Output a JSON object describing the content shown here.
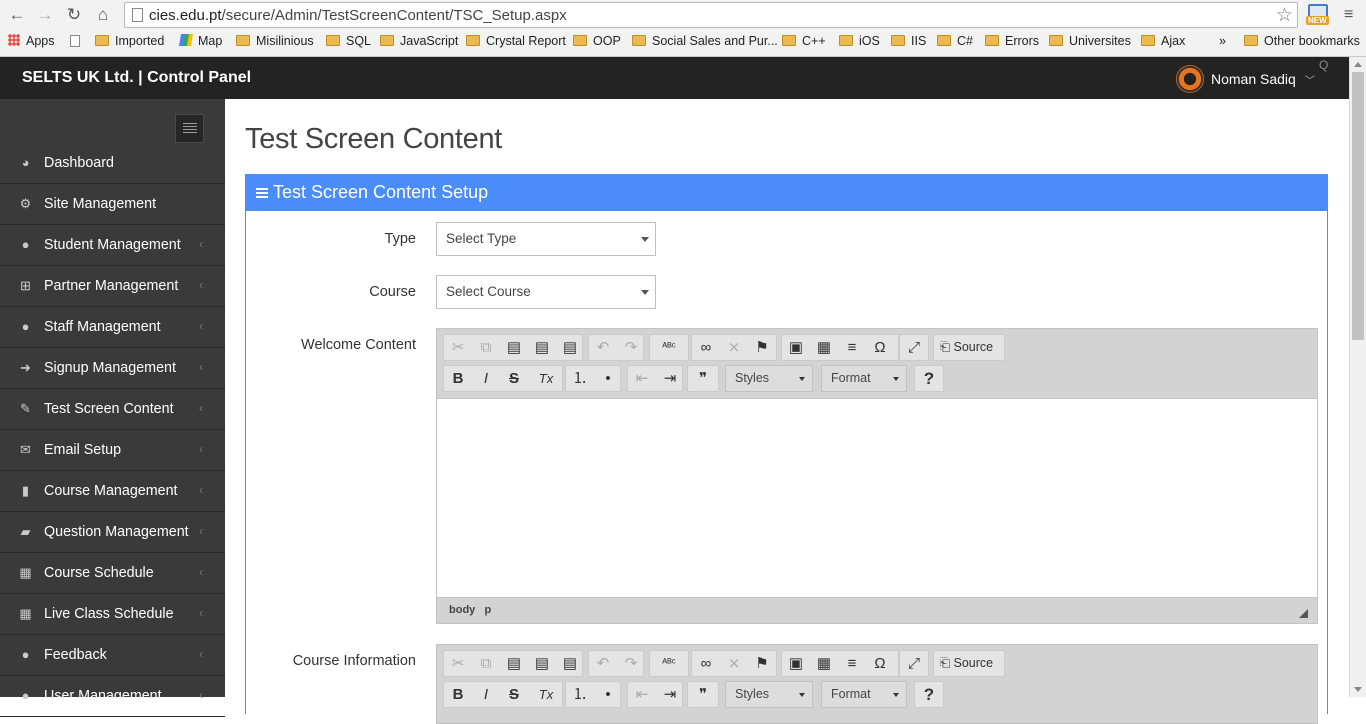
{
  "browser": {
    "url_domain": "cies.edu.pt",
    "url_path": "/secure/Admin/TestScreenContent/TSC_Setup.aspx",
    "ext_badge": "NEW",
    "bookmarks": [
      {
        "label": "Apps",
        "icon": "apps-icon"
      },
      {
        "label": "",
        "icon": "page-icon"
      },
      {
        "label": "Imported",
        "icon": "folder-icon"
      },
      {
        "label": "Map",
        "icon": "maps-icon"
      },
      {
        "label": "Misilinious",
        "icon": "folder-icon"
      },
      {
        "label": "SQL",
        "icon": "folder-icon"
      },
      {
        "label": "JavaScript",
        "icon": "folder-icon"
      },
      {
        "label": "Crystal Report",
        "icon": "folder-icon"
      },
      {
        "label": "OOP",
        "icon": "folder-icon"
      },
      {
        "label": "Social Sales and Pur...",
        "icon": "folder-icon"
      },
      {
        "label": "C++",
        "icon": "folder-icon"
      },
      {
        "label": "iOS",
        "icon": "folder-icon"
      },
      {
        "label": "IIS",
        "icon": "folder-icon"
      },
      {
        "label": "C#",
        "icon": "folder-icon"
      },
      {
        "label": "Errors",
        "icon": "folder-icon"
      },
      {
        "label": "Universites",
        "icon": "folder-icon"
      },
      {
        "label": "Ajax",
        "icon": "folder-icon"
      }
    ],
    "overflow": "»",
    "other_bookmarks": "Other bookmarks"
  },
  "header": {
    "brand": "SELTS UK Ltd. | Control Panel",
    "user_name": "Noman Sadiq",
    "user_chevron": "﹀",
    "corner_mark": "Q"
  },
  "sidebar": {
    "items": [
      {
        "label": "Dashboard",
        "icon": "dashboard-icon",
        "glyph": "◕",
        "arrow": ""
      },
      {
        "label": "Site Management",
        "icon": "cogs-icon",
        "glyph": "⚙",
        "arrow": ""
      },
      {
        "label": "Student Management",
        "icon": "user-icon",
        "glyph": "●",
        "arrow": "‹"
      },
      {
        "label": "Partner Management",
        "icon": "sitemap-icon",
        "glyph": "⊞",
        "arrow": "‹"
      },
      {
        "label": "Staff Management",
        "icon": "users-icon",
        "glyph": "●",
        "arrow": "‹"
      },
      {
        "label": "Signup Management",
        "icon": "sign-in-icon",
        "glyph": "➜",
        "arrow": "‹"
      },
      {
        "label": "Test Screen Content",
        "icon": "edit-icon",
        "glyph": "✎",
        "arrow": "‹"
      },
      {
        "label": "Email Setup",
        "icon": "envelope-icon",
        "glyph": "✉",
        "arrow": "‹"
      },
      {
        "label": "Course Management",
        "icon": "book-icon",
        "glyph": "▮",
        "arrow": "‹"
      },
      {
        "label": "Question Management",
        "icon": "folder-open-icon",
        "glyph": "▰",
        "arrow": "‹"
      },
      {
        "label": "Course Schedule",
        "icon": "calendar-icon",
        "glyph": "▦",
        "arrow": "‹"
      },
      {
        "label": "Live Class Schedule",
        "icon": "calendar-icon",
        "glyph": "▦",
        "arrow": "‹"
      },
      {
        "label": "Feedback",
        "icon": "comments-icon",
        "glyph": "●",
        "arrow": "‹"
      },
      {
        "label": "User Management",
        "icon": "user-icon",
        "glyph": "●",
        "arrow": "‹"
      }
    ]
  },
  "main": {
    "title": "Test Screen Content",
    "panel_title": "Test Screen Content Setup",
    "type_label": "Type",
    "type_value": "Select Type",
    "course_label": "Course",
    "course_value": "Select Course",
    "welcome_label": "Welcome Content",
    "course_info_label": "Course Information"
  },
  "editor": {
    "source_label": "Source",
    "styles_label": "Styles",
    "format_label": "Format",
    "help_glyph": "?",
    "path_body": "body",
    "path_p": "p",
    "glyphs": {
      "cut": "✂",
      "copy": "⧉",
      "paste": "▤",
      "paste_text": "▤",
      "paste_word": "▤",
      "undo": "↶",
      "redo": "↷",
      "spell": "ᴬᴮᶜ",
      "link": "∞",
      "unlink": "⨯",
      "anchor": "⚑",
      "image": "▣",
      "table": "▦",
      "hr": "≡",
      "special": "Ω",
      "maximize": "⤢",
      "source": "⎗",
      "bold": "B",
      "italic": "I",
      "strike": "S",
      "removeformat": "Tx",
      "numlist": "⒈",
      "bullist": "•",
      "outdent": "⇤",
      "indent": "⇥",
      "quote": "❞"
    }
  }
}
